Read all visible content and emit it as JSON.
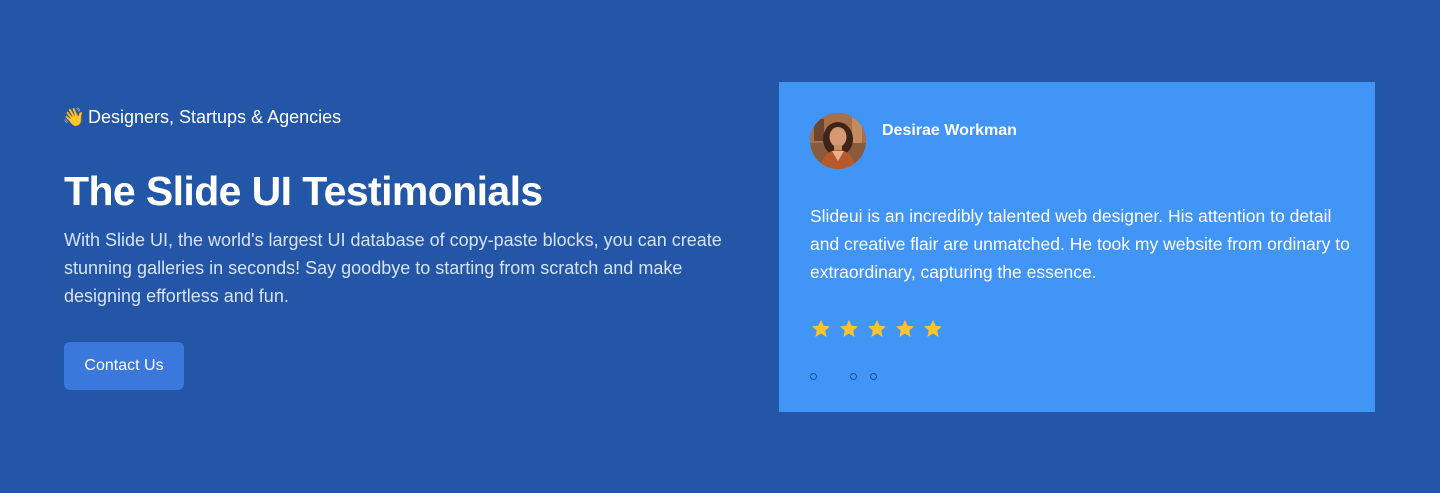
{
  "hero": {
    "eyebrow_emoji": "👋",
    "eyebrow_text": "Designers, Startups & Agencies",
    "title": "The Slide UI Testimonials",
    "description": "With Slide UI, the world's largest UI database of copy-paste blocks, you can create stunning galleries in seconds! Say goodbye to starting from scratch and make designing effortless and fun.",
    "cta_label": "Contact Us"
  },
  "testimonial": {
    "author_name": "Desirae Workman",
    "avatar_icon": "person-avatar",
    "quote": "Slideui is an incredibly talented web designer. His attention to detail and creative flair are unmatched. He took my website from ordinary to extraordinary, capturing the essence.",
    "rating": 5,
    "rating_max": 5,
    "slides_total": 3
  },
  "colors": {
    "background": "#2356a6",
    "card": "#4095f6",
    "button": "#3b78db",
    "star": "#f7c32e"
  }
}
